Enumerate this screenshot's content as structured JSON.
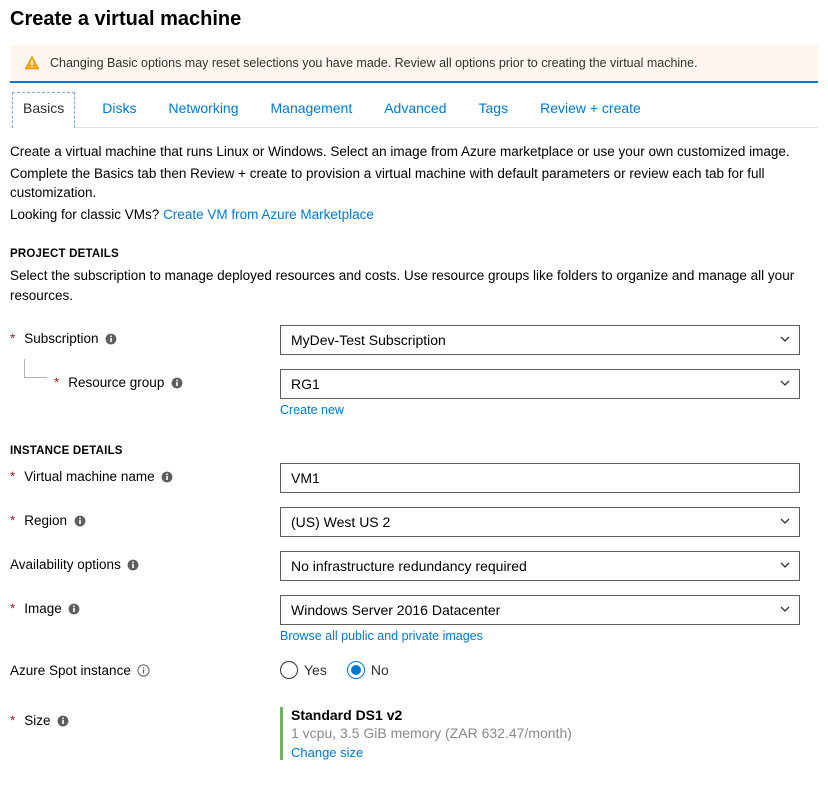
{
  "page": {
    "title": "Create a virtual machine"
  },
  "warning": {
    "text": "Changing Basic options may reset selections you have made. Review all options prior to creating the virtual machine."
  },
  "tabs": [
    {
      "label": "Basics",
      "active": true
    },
    {
      "label": "Disks",
      "active": false
    },
    {
      "label": "Networking",
      "active": false
    },
    {
      "label": "Management",
      "active": false
    },
    {
      "label": "Advanced",
      "active": false
    },
    {
      "label": "Tags",
      "active": false
    },
    {
      "label": "Review + create",
      "active": false
    }
  ],
  "intro": {
    "line1": "Create a virtual machine that runs Linux or Windows. Select an image from Azure marketplace or use your own customized image.",
    "line2": "Complete the Basics tab then Review + create to provision a virtual machine with default parameters or review each tab for full customization.",
    "line3_prefix": "Looking for classic VMs?  ",
    "line3_link": "Create VM from Azure Marketplace"
  },
  "project_details": {
    "heading": "PROJECT DETAILS",
    "desc": "Select the subscription to manage deployed resources and costs. Use resource groups like folders to organize and manage all your resources.",
    "subscription": {
      "label": "Subscription",
      "value": "MyDev-Test Subscription"
    },
    "resource_group": {
      "label": "Resource group",
      "value": "RG1",
      "create_new": "Create new"
    }
  },
  "instance_details": {
    "heading": "INSTANCE DETAILS",
    "vm_name": {
      "label": "Virtual machine name",
      "value": "VM1"
    },
    "region": {
      "label": "Region",
      "value": "(US) West US 2"
    },
    "availability": {
      "label": "Availability options",
      "value": "No infrastructure redundancy required"
    },
    "image": {
      "label": "Image",
      "value": "Windows Server 2016 Datacenter",
      "browse_link": "Browse all public and private images"
    },
    "spot": {
      "label": "Azure Spot instance",
      "yes": "Yes",
      "no": "No",
      "selected": "no"
    },
    "size": {
      "label": "Size",
      "name": "Standard DS1 v2",
      "desc": "1 vcpu, 3.5 GiB memory (ZAR 632.47/month)",
      "change_link": "Change size"
    }
  }
}
